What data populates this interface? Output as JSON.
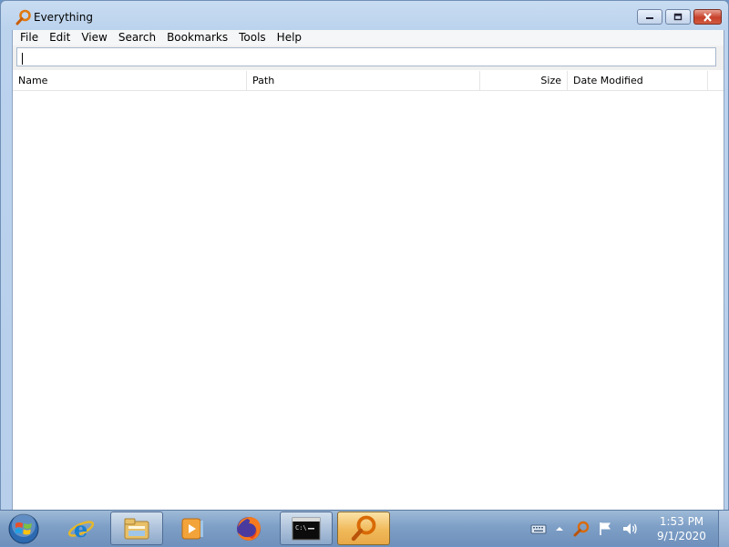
{
  "window": {
    "title": "Everything"
  },
  "menu": [
    "File",
    "Edit",
    "View",
    "Search",
    "Bookmarks",
    "Tools",
    "Help"
  ],
  "search": {
    "value": "",
    "placeholder": ""
  },
  "columns": {
    "name": "Name",
    "path": "Path",
    "size": "Size",
    "date_modified": "Date Modified"
  },
  "taskbar": {
    "items": [
      "start-orb",
      "internet-explorer",
      "windows-explorer",
      "media-player",
      "firefox",
      "command-prompt",
      "everything"
    ],
    "clock": {
      "time": "1:53 PM",
      "date": "9/1/2020"
    }
  },
  "colors": {
    "accent_active_taskbar": "#f0b95a",
    "close_button": "#c7402a"
  }
}
